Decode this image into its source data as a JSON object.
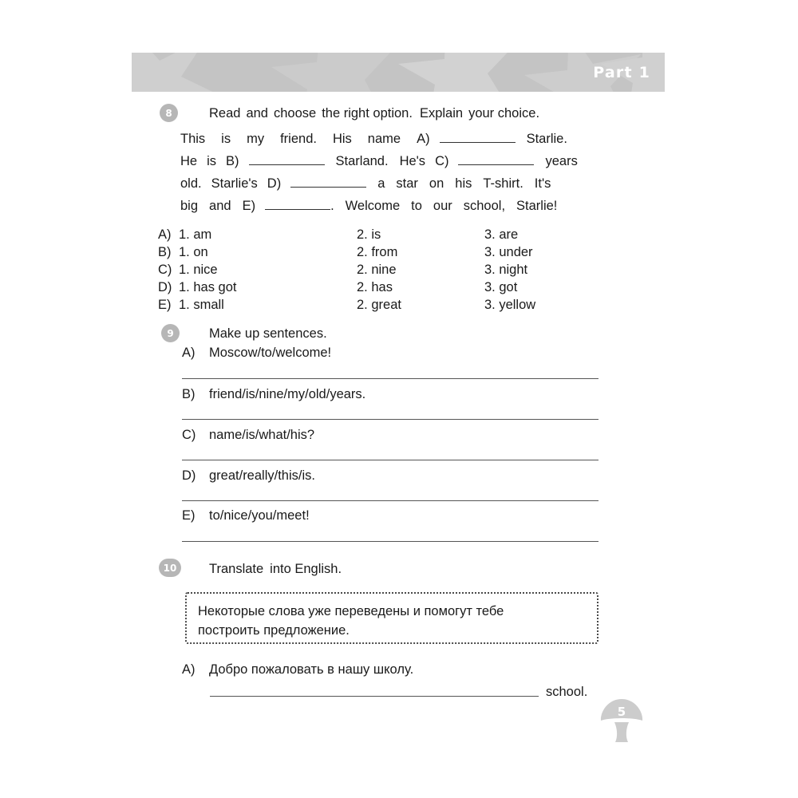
{
  "header": {
    "part_label": "Part 1",
    "banner_color": "#c4c4c4",
    "star_color": "#cfcfcf"
  },
  "exercise8": {
    "number": "8",
    "instruction": {
      "bold1": "Read",
      "plain1": "and",
      "bold2": "choose",
      "plain2": "the right option.",
      "bold3": "Explain",
      "plain3": "your choice."
    },
    "passage_lines": [
      [
        "This",
        "is",
        "my",
        "friend.",
        "His",
        "name",
        "A)",
        "___BLANK___",
        "Starlie."
      ],
      [
        "He",
        "is",
        "B)",
        "___BLANK___",
        "Starland.",
        "He's",
        "C)",
        "___BLANK___",
        "years"
      ],
      [
        "old.",
        "Starlie's",
        "D)",
        "___BLANK___",
        "a",
        "star",
        "on",
        "his",
        "T-shirt.",
        "It's"
      ],
      [
        "big",
        "and",
        "E)",
        "___BLANK___",
        ".",
        "Welcome",
        "to",
        "our",
        "school,",
        "Starlie!"
      ]
    ],
    "passage_text": "This is my friend. His name A) __________ Starlie. He is B) __________ Starland. He's C) __________ years old. Starlie's D) __________ a star on his T-shirt. It's big and E) _________. Welcome to our school, Starlie!",
    "options": [
      {
        "letter": "A)",
        "choices": [
          "1.  am",
          "2.  is",
          "3.  are"
        ]
      },
      {
        "letter": "B)",
        "choices": [
          "1.  on",
          "2.  from",
          "3.  under"
        ]
      },
      {
        "letter": "C)",
        "choices": [
          "1.  nice",
          "2.  nine",
          "3.  night"
        ]
      },
      {
        "letter": "D)",
        "choices": [
          "1.  has  got",
          "2.  has",
          "3.  got"
        ]
      },
      {
        "letter": "E)",
        "choices": [
          "1.  small",
          "2.  great",
          "3.  yellow"
        ]
      }
    ]
  },
  "exercise9": {
    "number": "9",
    "instruction_bold": "Make  up  sentences",
    "instruction_tail": ".",
    "items": [
      {
        "letter": "A)",
        "text": "Moscow/to/welcome!"
      },
      {
        "letter": "B)",
        "text": "friend/is/nine/my/old/years."
      },
      {
        "letter": "C)",
        "text": "name/is/what/his?"
      },
      {
        "letter": "D)",
        "text": "great/really/this/is."
      },
      {
        "letter": "E)",
        "text": "to/nice/you/meet!"
      }
    ]
  },
  "exercise10": {
    "number": "10",
    "instruction_bold": "Translate",
    "instruction_tail": "into  English.",
    "tip": {
      "line1": "Некоторые  слова  уже  переведены  и  помогут  тебе",
      "line2": "построить  предложение."
    },
    "items": [
      {
        "letter": "A)",
        "text": "Добро  пожаловать  в  нашу  школу.",
        "trailing": "school."
      }
    ]
  },
  "footer": {
    "page_number": "5",
    "mark_color": "#cccccc"
  }
}
